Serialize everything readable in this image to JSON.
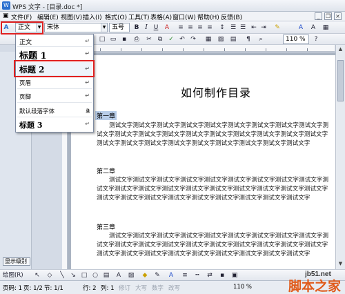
{
  "window": {
    "title": "WPS 文字 - [目录.doc *]"
  },
  "menu": [
    "文件(F)",
    "编辑(E)",
    "视图(V)",
    "插入(I)",
    "格式(O)",
    "工具(T)",
    "表格(A)",
    "窗口(W)",
    "帮助(H)",
    "反馈(B)"
  ],
  "format_toolbar": {
    "style_value": "正文",
    "font_value": "宋体",
    "size_value": "五号",
    "bold": "B",
    "italic": "I",
    "underline": "U",
    "font_color_letter": "A",
    "zoom_value": "110 %"
  },
  "style_dropdown": {
    "items": [
      {
        "label": "正文",
        "mark": "↵"
      },
      {
        "label": "标题 1",
        "mark": "↵"
      },
      {
        "label": "标题 2",
        "mark": "↵"
      },
      {
        "label": "页眉",
        "mark": "↵"
      },
      {
        "label": "页脚",
        "mark": "↵"
      },
      {
        "label": "默认段落字体",
        "mark": "a"
      },
      {
        "label": "标题 3",
        "mark": "↵"
      }
    ]
  },
  "left_pane": {
    "level_button": "显示级别"
  },
  "document": {
    "title": "如何制作目录",
    "sections": [
      {
        "heading": "第一章",
        "body": "测试文字测试文字测试文字测试文字测试文字测试文字测试文字测试文字测试文字测试文字测试文字测试文字测试文字测试文字测试文字测试文字测试文字测试文字测试文字测试文字测试文字测试文字测试文字测试文字测试文字测试文字测试文字测试文字"
      },
      {
        "heading": "第二章",
        "body": "测试文字测试文字测试文字测试文字测试文字测试文字测试文字测试文字测试文字测试文字测试文字测试文字测试文字测试文字测试文字测试文字测试文字测试文字测试文字测试文字测试文字测试文字测试文字测试文字测试文字测试文字测试文字测试文字"
      },
      {
        "heading": "第三章",
        "body": "测试文字测试文字测试文字测试文字测试文字测试文字测试文字测试文字测试文字测试文字测试文字测试文字测试文字测试文字测试文字测试文字测试文字测试文字测试文字测试文字测试文字测试文字测试文字测试文字测试文字测试文字测试文字测试文字"
      }
    ]
  },
  "drawing_toolbar": {
    "label": "绘图(R)"
  },
  "status_bar": {
    "page_no": "页码: 1",
    "page_of": "页: 1/2",
    "section": "节: 1/1",
    "row": "行: 2",
    "col": "列: 1",
    "rev": "修订",
    "caps": "大写",
    "num": "数字",
    "ovr": "改写",
    "zoom": "110 %"
  },
  "watermark": {
    "site": "jb51.net",
    "brand": "脚本之家"
  },
  "colors": {
    "highlight_red": "#e01f1f",
    "selection_blue": "#b8cde8"
  }
}
